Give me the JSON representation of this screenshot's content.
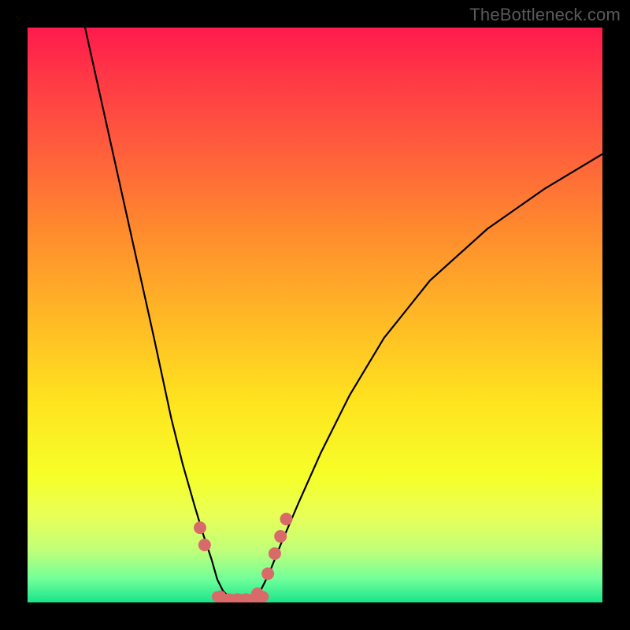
{
  "watermark": "TheBottleneck.com",
  "chart_data": {
    "type": "line",
    "title": "",
    "xlabel": "",
    "ylabel": "",
    "xlim": [
      0,
      100
    ],
    "ylim": [
      0,
      100
    ],
    "curve_left": {
      "x": [
        10,
        14,
        18,
        22,
        25,
        27,
        29,
        30.5,
        32,
        33,
        34,
        35
      ],
      "y": [
        100,
        82,
        64,
        46,
        32,
        24,
        17,
        12,
        7.5,
        4,
        2,
        1
      ]
    },
    "curve_right": {
      "x": [
        40,
        42,
        44,
        47,
        51,
        56,
        62,
        70,
        80,
        90,
        100
      ],
      "y": [
        1,
        5,
        10,
        17,
        26,
        36,
        46,
        56,
        65,
        72,
        78
      ]
    },
    "bottom_flat": {
      "x": [
        33,
        35,
        37,
        39,
        41
      ],
      "y": [
        1,
        0.5,
        0.5,
        0.5,
        1
      ]
    },
    "highlight_dots": [
      {
        "x": 30.0,
        "y": 13.0
      },
      {
        "x": 30.8,
        "y": 10.0
      },
      {
        "x": 33.5,
        "y": 1.0
      },
      {
        "x": 35.0,
        "y": 0.5
      },
      {
        "x": 36.5,
        "y": 0.5
      },
      {
        "x": 38.0,
        "y": 0.5
      },
      {
        "x": 40.0,
        "y": 1.5
      },
      {
        "x": 41.8,
        "y": 5.0
      },
      {
        "x": 43.0,
        "y": 8.5
      },
      {
        "x": 44.0,
        "y": 11.5
      },
      {
        "x": 45.0,
        "y": 14.5
      }
    ],
    "colors": {
      "curve": "#000000",
      "dots": "#d86a6a"
    }
  }
}
